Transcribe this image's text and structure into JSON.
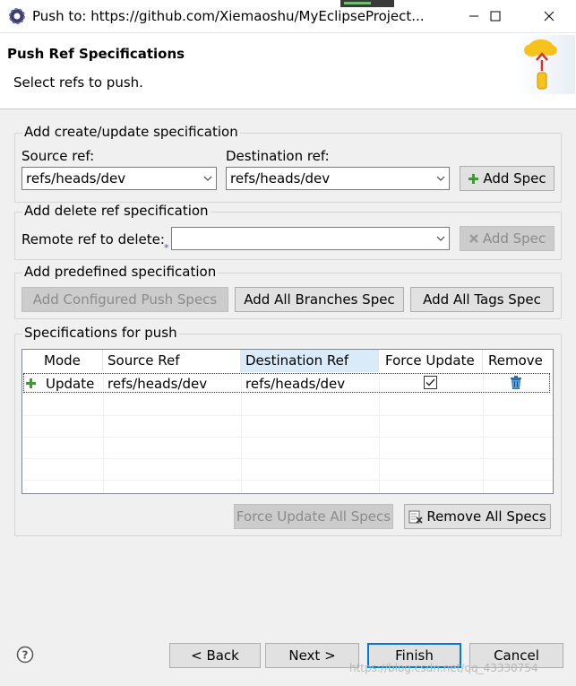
{
  "window": {
    "title": "Push to: https://github.com/Xiemaoshu/MyEclipseProject...",
    "minimize_icon": "minimize-icon",
    "maximize_icon": "maximize-icon",
    "close_icon": "close-icon"
  },
  "header": {
    "title": "Push Ref Specifications",
    "subtitle": "Select refs to push."
  },
  "create_group": {
    "legend": "Add create/update specification",
    "source_label": "Source ref:",
    "source_value": "refs/heads/dev",
    "dest_label": "Destination ref:",
    "dest_value": "refs/heads/dev",
    "add_spec_label": "Add Spec"
  },
  "delete_group": {
    "legend": "Add delete ref specification",
    "remote_label": "Remote ref to delete:",
    "remote_value": "",
    "add_spec_label": "Add Spec"
  },
  "predefined_group": {
    "legend": "Add predefined specification",
    "configured_label": "Add Configured Push Specs",
    "branches_label": "Add All Branches Spec",
    "tags_label": "Add All Tags Spec"
  },
  "specs_group": {
    "legend": "Specifications for push",
    "columns": [
      "Mode",
      "Source Ref",
      "Destination Ref",
      "Force Update",
      "Remove"
    ],
    "rows": [
      {
        "mode": "Update",
        "source": "refs/heads/dev",
        "destination": "refs/heads/dev",
        "force_update": true
      }
    ],
    "force_all_label": "Force Update All Specs",
    "remove_all_label": "Remove All Specs"
  },
  "footer": {
    "back_label": "< Back",
    "next_label": "Next >",
    "finish_label": "Finish",
    "cancel_label": "Cancel",
    "watermark": "https://blog.csdn.net/qq_43330754"
  },
  "colors": {
    "accent": "#0078d7",
    "add_green": "#3c9a2e",
    "trash_blue": "#2a6fb0"
  }
}
